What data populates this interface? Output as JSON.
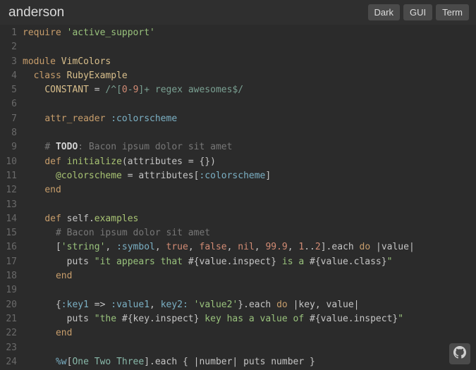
{
  "header": {
    "title": "anderson",
    "buttons": {
      "dark": "Dark",
      "gui": "GUI",
      "term": "Term"
    }
  },
  "github_icon": "github-icon",
  "lineNumbers": [
    "1",
    "2",
    "3",
    "4",
    "5",
    "6",
    "7",
    "8",
    "9",
    "10",
    "11",
    "12",
    "13",
    "14",
    "15",
    "16",
    "17",
    "18",
    "19",
    "20",
    "21",
    "22",
    "23",
    "24"
  ],
  "code": [
    [
      {
        "c": "kw",
        "t": "require"
      },
      {
        "c": "punc",
        "t": " "
      },
      {
        "c": "str",
        "t": "'active_support'"
      }
    ],
    [],
    [
      {
        "c": "kw",
        "t": "module"
      },
      {
        "c": "punc",
        "t": " "
      },
      {
        "c": "const",
        "t": "VimColors"
      }
    ],
    [
      {
        "c": "punc",
        "t": "  "
      },
      {
        "c": "kw",
        "t": "class"
      },
      {
        "c": "punc",
        "t": " "
      },
      {
        "c": "const",
        "t": "RubyExample"
      }
    ],
    [
      {
        "c": "punc",
        "t": "    "
      },
      {
        "c": "const",
        "t": "CONSTANT"
      },
      {
        "c": "punc",
        "t": " = "
      },
      {
        "c": "rgx",
        "t": "/^["
      },
      {
        "c": "num",
        "t": "0"
      },
      {
        "c": "rgx",
        "t": "-"
      },
      {
        "c": "num",
        "t": "9"
      },
      {
        "c": "rgx",
        "t": "]+ regex awesomes$/"
      }
    ],
    [],
    [
      {
        "c": "punc",
        "t": "    "
      },
      {
        "c": "kw",
        "t": "attr_reader"
      },
      {
        "c": "punc",
        "t": " "
      },
      {
        "c": "sym",
        "t": ":colorscheme"
      }
    ],
    [],
    [
      {
        "c": "punc",
        "t": "    "
      },
      {
        "c": "cmt",
        "t": "# "
      },
      {
        "c": "todo",
        "t": "TODO"
      },
      {
        "c": "cmt",
        "t": ": Bacon ipsum dolor sit amet"
      }
    ],
    [
      {
        "c": "punc",
        "t": "    "
      },
      {
        "c": "kw",
        "t": "def"
      },
      {
        "c": "punc",
        "t": " "
      },
      {
        "c": "meth",
        "t": "initialize"
      },
      {
        "c": "punc",
        "t": "(attributes = {})"
      }
    ],
    [
      {
        "c": "punc",
        "t": "      "
      },
      {
        "c": "ivar",
        "t": "@colorscheme"
      },
      {
        "c": "punc",
        "t": " = attributes["
      },
      {
        "c": "sym",
        "t": ":colorscheme"
      },
      {
        "c": "punc",
        "t": "]"
      }
    ],
    [
      {
        "c": "punc",
        "t": "    "
      },
      {
        "c": "kw",
        "t": "end"
      }
    ],
    [],
    [
      {
        "c": "punc",
        "t": "    "
      },
      {
        "c": "kw",
        "t": "def"
      },
      {
        "c": "punc",
        "t": " "
      },
      {
        "c": "id",
        "t": "self"
      },
      {
        "c": "punc",
        "t": "."
      },
      {
        "c": "meth",
        "t": "examples"
      }
    ],
    [
      {
        "c": "punc",
        "t": "      "
      },
      {
        "c": "cmt",
        "t": "# Bacon ipsum dolor sit amet"
      }
    ],
    [
      {
        "c": "punc",
        "t": "      ["
      },
      {
        "c": "str",
        "t": "'string'"
      },
      {
        "c": "punc",
        "t": ", "
      },
      {
        "c": "sym",
        "t": ":symbol"
      },
      {
        "c": "punc",
        "t": ", "
      },
      {
        "c": "bool",
        "t": "true"
      },
      {
        "c": "punc",
        "t": ", "
      },
      {
        "c": "bool",
        "t": "false"
      },
      {
        "c": "punc",
        "t": ", "
      },
      {
        "c": "bool",
        "t": "nil"
      },
      {
        "c": "punc",
        "t": ", "
      },
      {
        "c": "num",
        "t": "99.9"
      },
      {
        "c": "punc",
        "t": ", "
      },
      {
        "c": "num",
        "t": "1"
      },
      {
        "c": "punc",
        "t": ".."
      },
      {
        "c": "num",
        "t": "2"
      },
      {
        "c": "punc",
        "t": "].each "
      },
      {
        "c": "kw",
        "t": "do"
      },
      {
        "c": "punc",
        "t": " |value|"
      }
    ],
    [
      {
        "c": "punc",
        "t": "        puts "
      },
      {
        "c": "str",
        "t": "\"it appears that "
      },
      {
        "c": "interp",
        "t": "#{value.inspect}"
      },
      {
        "c": "str",
        "t": " is a "
      },
      {
        "c": "interp",
        "t": "#{value.class}"
      },
      {
        "c": "str",
        "t": "\""
      }
    ],
    [
      {
        "c": "punc",
        "t": "      "
      },
      {
        "c": "kw",
        "t": "end"
      }
    ],
    [],
    [
      {
        "c": "punc",
        "t": "      {"
      },
      {
        "c": "sym",
        "t": ":key1"
      },
      {
        "c": "punc",
        "t": " => "
      },
      {
        "c": "sym",
        "t": ":value1"
      },
      {
        "c": "punc",
        "t": ", "
      },
      {
        "c": "sym",
        "t": "key2:"
      },
      {
        "c": "punc",
        "t": " "
      },
      {
        "c": "str",
        "t": "'value2'"
      },
      {
        "c": "punc",
        "t": "}.each "
      },
      {
        "c": "kw",
        "t": "do"
      },
      {
        "c": "punc",
        "t": " |key, value|"
      }
    ],
    [
      {
        "c": "punc",
        "t": "        puts "
      },
      {
        "c": "str",
        "t": "\"the "
      },
      {
        "c": "interp",
        "t": "#{key.inspect}"
      },
      {
        "c": "str",
        "t": " key has a value of "
      },
      {
        "c": "interp",
        "t": "#{value.inspect}"
      },
      {
        "c": "str",
        "t": "\""
      }
    ],
    [
      {
        "c": "punc",
        "t": "      "
      },
      {
        "c": "kw",
        "t": "end"
      }
    ],
    [],
    [
      {
        "c": "punc",
        "t": "      "
      },
      {
        "c": "sym",
        "t": "%w"
      },
      {
        "c": "punc",
        "t": "["
      },
      {
        "c": "wlit",
        "t": "One Two Three"
      },
      {
        "c": "punc",
        "t": "].each { |number| puts number }"
      }
    ]
  ]
}
